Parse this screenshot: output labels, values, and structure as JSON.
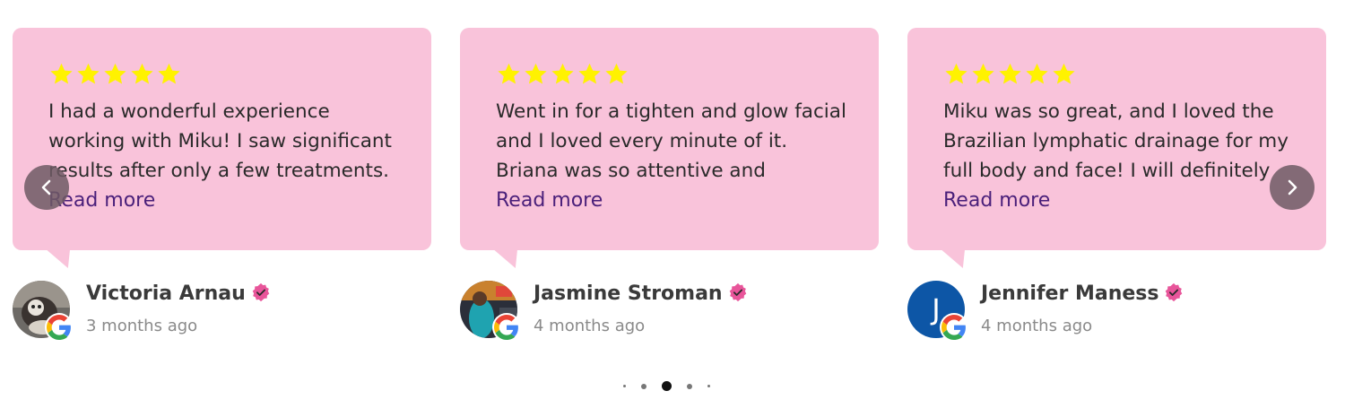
{
  "colors": {
    "card": "#f9c3da",
    "star": "#fff200",
    "read_more": "#4a1f7a",
    "verified": "#e8559a"
  },
  "reviews": [
    {
      "rating": 5,
      "text": "I had a wonderful experience working with Miku! I saw significant results after only a few treatments.",
      "read_more": "Read more",
      "name": "Victoria Arnau",
      "time": "3 months ago",
      "avatar": "photo-cat"
    },
    {
      "rating": 5,
      "text": "Went in for a tighten and glow facial and I loved every minute of it. Briana was so attentive and",
      "read_more": "Read more",
      "name": "Jasmine Stroman",
      "time": "4 months ago",
      "avatar": "photo-person"
    },
    {
      "rating": 5,
      "text": "Miku was so great, and I loved the Brazilian lymphatic drainage for my full body and face! I will definitely",
      "read_more": "Read more",
      "name": "Jennifer Maness",
      "time": "4 months ago",
      "avatar_letter": "J"
    }
  ],
  "carousel": {
    "dot_count": 5,
    "active_dot": 3
  }
}
